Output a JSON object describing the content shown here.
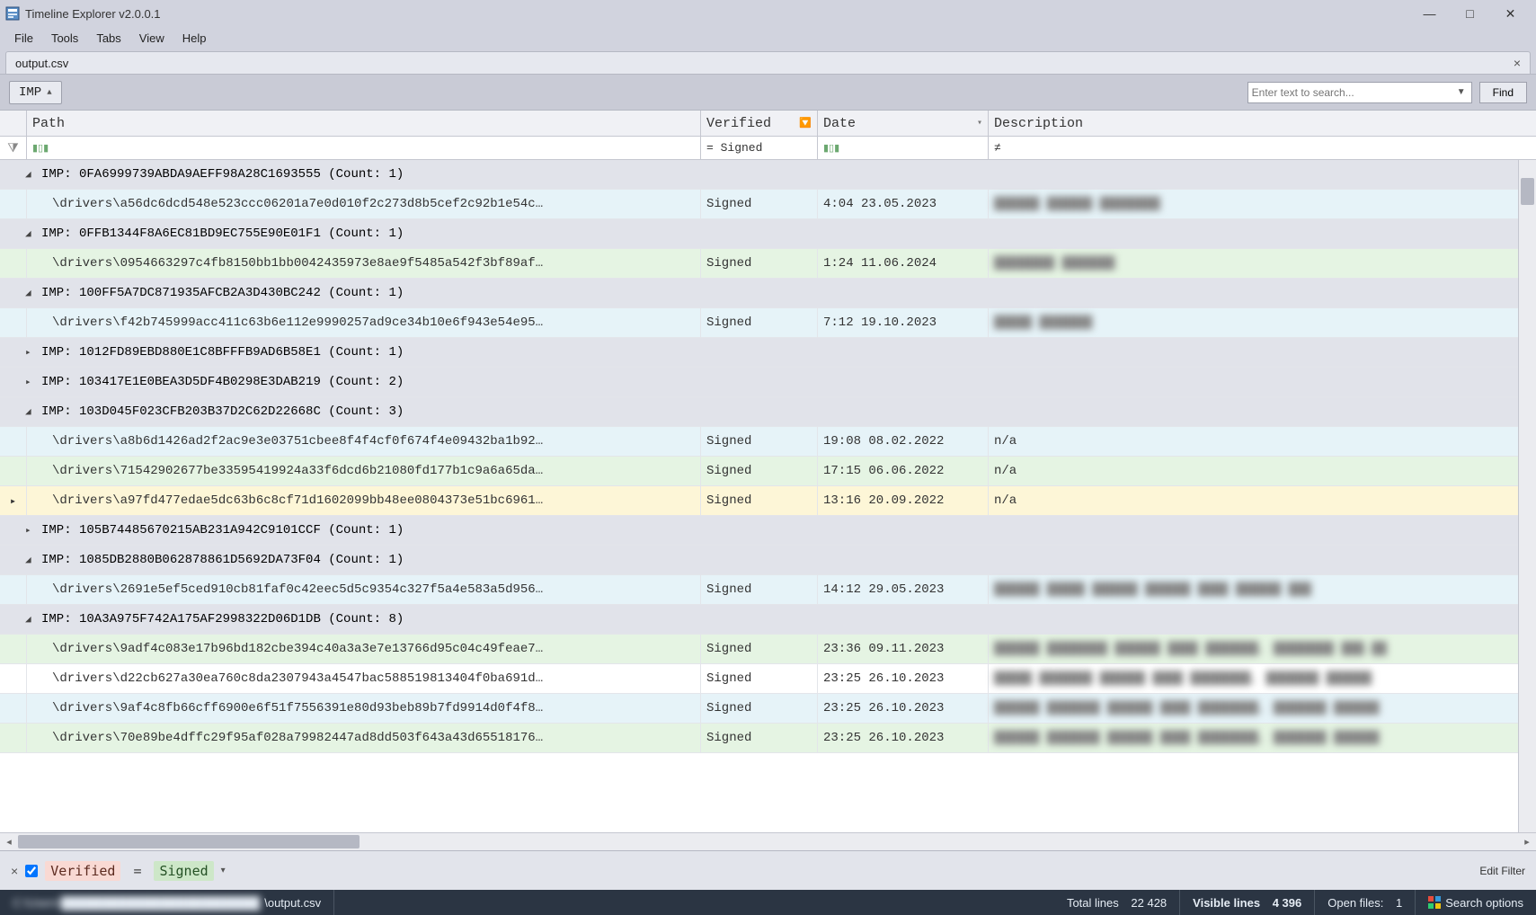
{
  "app": {
    "title": "Timeline Explorer v2.0.0.1"
  },
  "menu": {
    "file": "File",
    "tools": "Tools",
    "tabs": "Tabs",
    "view": "View",
    "help": "Help"
  },
  "tab": {
    "name": "output.csv"
  },
  "group": {
    "chip": "IMP"
  },
  "search": {
    "placeholder": "Enter text to search...",
    "find": "Find"
  },
  "columns": {
    "path": "Path",
    "verified": "Verified",
    "date": "Date",
    "description": "Description"
  },
  "filter_row": {
    "verified": "= Signed",
    "desc": "≠"
  },
  "filterbar": {
    "field": "Verified",
    "op": "=",
    "value": "Signed",
    "edit": "Edit Filter"
  },
  "status": {
    "path_prefix": "C:\\Users\\████████████████████████",
    "path_suffix": "\\output.csv",
    "total_label": "Total lines",
    "total_value": "22 428",
    "visible_label": "Visible lines",
    "visible_value": "4 396",
    "open_label": "Open files:",
    "open_value": "1",
    "search_options": "Search options"
  },
  "rows": [
    {
      "type": "group",
      "expanded": true,
      "imp": "0FA6999739ABDA9AEFF98A28C1693555",
      "count": 1
    },
    {
      "type": "data",
      "bg": "blue",
      "path": "\\drivers\\a56dc6dcd548e523ccc06201a7e0d010f2c273d8b5cef2c92b1e54c…",
      "verified": "Signed",
      "date": "4:04 23.05.2023",
      "desc": "██████ ██████ ████████"
    },
    {
      "type": "group",
      "expanded": true,
      "imp": "0FFB1344F8A6EC81BD9EC755E90E01F1",
      "count": 1
    },
    {
      "type": "data",
      "bg": "green",
      "path": "\\drivers\\0954663297c4fb8150bb1bb0042435973e8ae9f5485a542f3bf89af…",
      "verified": "Signed",
      "date": "1:24 11.06.2024",
      "desc": "████████ ███████"
    },
    {
      "type": "group",
      "expanded": true,
      "imp": "100FF5A7DC871935AFCB2A3D430BC242",
      "count": 1
    },
    {
      "type": "data",
      "bg": "blue",
      "path": "\\drivers\\f42b745999acc411c63b6e112e9990257ad9ce34b10e6f943e54e95…",
      "verified": "Signed",
      "date": "7:12 19.10.2023",
      "desc": "█████ ███████"
    },
    {
      "type": "group",
      "expanded": false,
      "imp": "1012FD89EBD880E1C8BFFFB9AD6B58E1",
      "count": 1
    },
    {
      "type": "group",
      "expanded": false,
      "imp": "103417E1E0BEA3D5DF4B0298E3DAB219",
      "count": 2
    },
    {
      "type": "group",
      "expanded": true,
      "imp": "103D045F023CFB203B37D2C62D22668C",
      "count": 3
    },
    {
      "type": "data",
      "bg": "blue",
      "path": "\\drivers\\a8b6d1426ad2f2ac9e3e03751cbee8f4f4cf0f674f4e09432ba1b92…",
      "verified": "Signed",
      "date": "19:08 08.02.2022",
      "desc": "n/a"
    },
    {
      "type": "data",
      "bg": "green",
      "path": "\\drivers\\71542902677be33595419924a33f6dcd6b21080fd177b1c9a6a65da…",
      "verified": "Signed",
      "date": "17:15 06.06.2022",
      "desc": "n/a"
    },
    {
      "type": "data",
      "bg": "yellow",
      "indicator": true,
      "path": "\\drivers\\a97fd477edae5dc63b6c8cf71d1602099bb48ee0804373e51bc6961…",
      "verified": "Signed",
      "date": "13:16 20.09.2022",
      "desc": "n/a"
    },
    {
      "type": "group",
      "expanded": false,
      "imp": "105B74485670215AB231A942C9101CCF",
      "count": 1
    },
    {
      "type": "group",
      "expanded": true,
      "imp": "1085DB2880B062878861D5692DA73F04",
      "count": 1
    },
    {
      "type": "data",
      "bg": "blue",
      "path": "\\drivers\\2691e5ef5ced910cb81faf0c42eec5d5c9354c327f5a4e583a5d956…",
      "verified": "Signed",
      "date": "14:12 29.05.2023",
      "desc": "██████ █████ ██████ ██████ ████ ██████ ███"
    },
    {
      "type": "group",
      "expanded": true,
      "imp": "10A3A975F742A175AF2998322D06D1DB",
      "count": 8
    },
    {
      "type": "data",
      "bg": "green",
      "path": "\\drivers\\9adf4c083e17b96bd182cbe394c40a3a3e7e13766d95c04c49feae7…",
      "verified": "Signed",
      "date": "23:36 09.11.2023",
      "desc": "██████ ████████ ██████ ████ ███████, ████████ ███.██"
    },
    {
      "type": "data",
      "bg": "white",
      "path": "\\drivers\\d22cb627a30ea760c8da2307943a4547bac588519813404f0ba691d…",
      "verified": "Signed",
      "date": "23:25 26.10.2023",
      "desc": "█████ ███████ ██████ ████ ████████, ███████ ██████"
    },
    {
      "type": "data",
      "bg": "blue",
      "path": "\\drivers\\9af4c8fb66cff6900e6f51f7556391e80d93beb89b7fd9914d0f4f8…",
      "verified": "Signed",
      "date": "23:25 26.10.2023",
      "desc": "██████ ███████ ██████ ████ ████████, ███████ ██████"
    },
    {
      "type": "data",
      "bg": "green",
      "path": "\\drivers\\70e89be4dffc29f95af028a79982447ad8dd503f643a43d65518176…",
      "verified": "Signed",
      "date": "23:25 26.10.2023",
      "desc": "██████ ███████ ██████ ████ ████████, ███████ ██████"
    }
  ]
}
